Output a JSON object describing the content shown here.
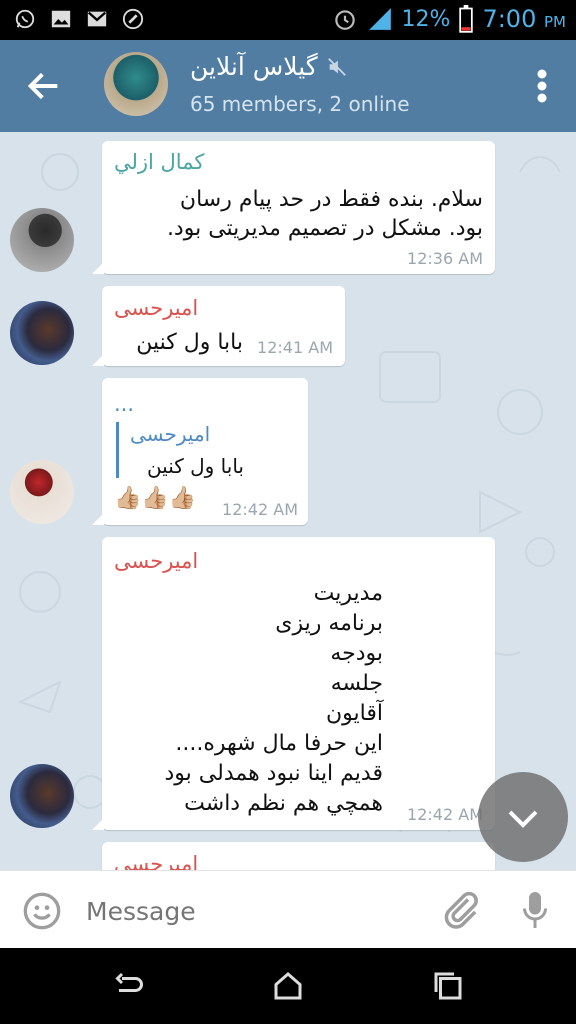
{
  "status_bar": {
    "battery_percent": "12%",
    "time": "7:00",
    "ampm": "PM",
    "accent_color": "#4fb3e8",
    "icons": [
      "whatsapp-icon",
      "gallery-icon",
      "gmail-icon",
      "phone-icon",
      "alarm-icon",
      "signal-icon",
      "battery-icon"
    ]
  },
  "header": {
    "title": "گیلاس آنلاین",
    "subtitle": "65 members, 2 online",
    "muted": true,
    "bar_color": "#527da3"
  },
  "messages": [
    {
      "sender": "كمال ازلي",
      "sender_color": "#4aa5a4",
      "text": "سلام. بنده فقط در حد پیام رسان\nبود. مشکل در تصمیم مدیریتی بود.",
      "time": "12:36 AM"
    },
    {
      "sender": "اميرحسى",
      "sender_color": "#d9534f",
      "text": "بابا ول کنین",
      "time": "12:41 AM"
    },
    {
      "sender": "...",
      "sender_color": "#4f8bc2",
      "reply_sender": "اميرحسى",
      "reply_text": "بابا ول کنین",
      "text": "👍🏼👍🏼👍🏼",
      "time": "12:42 AM"
    },
    {
      "sender": "اميرحسى",
      "sender_color": "#d9534f",
      "text": "مدیریت\nبرنامه ریزی\nبودجه\nجلسه\nآقایون\nاین حرفا مال شهره....\nقدیم اینا نبود همدلی بود\nهمچي هم نظم داشت",
      "time": "12:42 AM"
    },
    {
      "sender": "اميرحسى",
      "sender_color": "#d9534f"
    }
  ],
  "composer": {
    "placeholder": "Message"
  },
  "colors": {
    "chat_background": "#d7e2ea",
    "bubble": "#ffffff"
  }
}
